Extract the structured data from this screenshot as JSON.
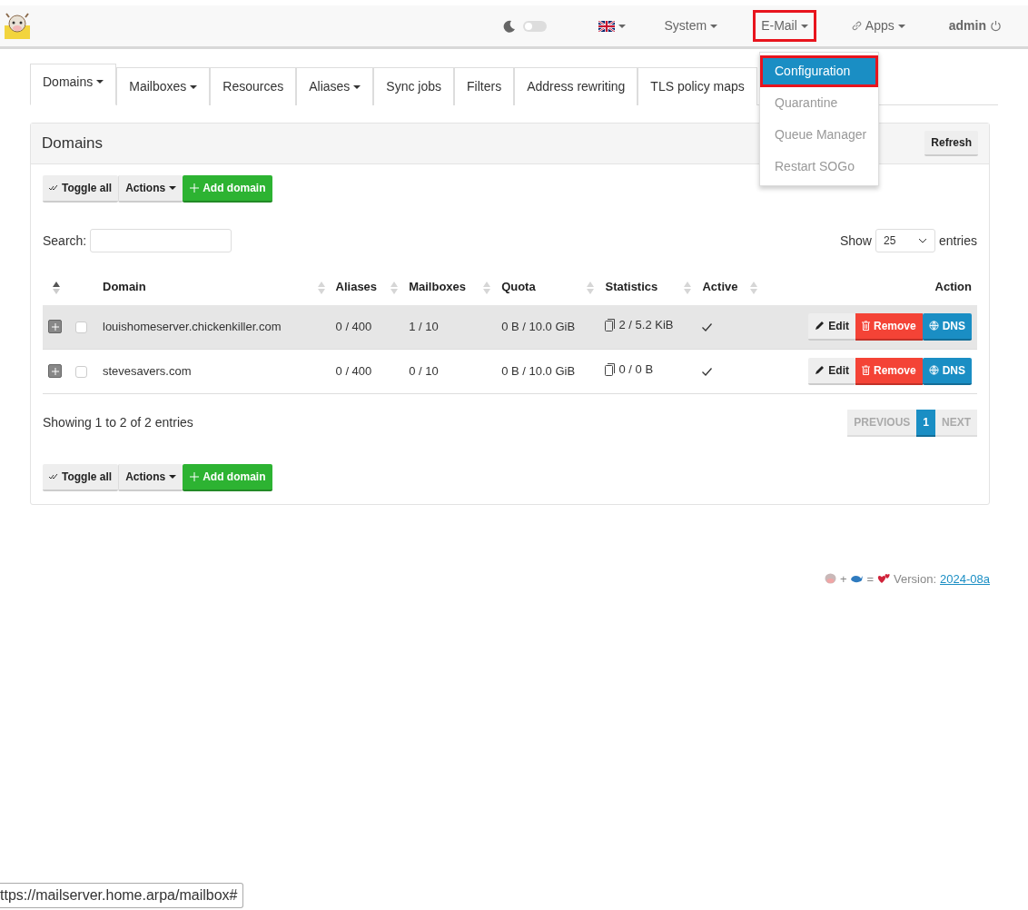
{
  "navbar": {
    "dark_mode_on": false,
    "items": [
      {
        "label": "System",
        "kind": "dropdown",
        "highlighted": false
      },
      {
        "label": "E-Mail",
        "kind": "dropdown",
        "highlighted": true
      },
      {
        "label": "Apps",
        "kind": "link-dropdown",
        "highlighted": false
      },
      {
        "label": "admin",
        "kind": "user",
        "highlighted": false
      }
    ]
  },
  "email_menu": [
    {
      "label": "Configuration",
      "selected": true,
      "highlighted": true
    },
    {
      "label": "Quarantine",
      "selected": false,
      "highlighted": false
    },
    {
      "label": "Queue Manager",
      "selected": false,
      "highlighted": false
    },
    {
      "label": "Restart SOGo",
      "selected": false,
      "highlighted": false
    }
  ],
  "tabs": [
    {
      "label": "Domains",
      "dropdown": true,
      "selected": true
    },
    {
      "label": "Mailboxes",
      "dropdown": true,
      "selected": false
    },
    {
      "label": "Resources",
      "dropdown": false,
      "selected": false
    },
    {
      "label": "Aliases",
      "dropdown": true,
      "selected": false
    },
    {
      "label": "Sync jobs",
      "dropdown": false,
      "selected": false
    },
    {
      "label": "Filters",
      "dropdown": false,
      "selected": false
    },
    {
      "label": "Address rewriting",
      "dropdown": false,
      "selected": false
    },
    {
      "label": "TLS policy maps",
      "dropdown": false,
      "selected": false
    }
  ],
  "panel": {
    "title": "Domains",
    "refresh": "Refresh",
    "toolbar": {
      "toggle": "Toggle all",
      "actions": "Actions",
      "add": "Add domain"
    },
    "search_label": "Search:",
    "show_label": "Show",
    "page_size": "25",
    "entries_label": "entries",
    "columns": [
      {
        "sortable": true,
        "sorted": true
      },
      {
        "label": "Domain",
        "sortable": true,
        "sorted": false
      },
      {
        "label": "Aliases",
        "sortable": true,
        "sorted": false
      },
      {
        "label": "Mailboxes",
        "sortable": true,
        "sorted": false
      },
      {
        "label": "Quota",
        "sortable": true,
        "sorted": false
      },
      {
        "label": "Statistics",
        "sortable": true,
        "sorted": false
      },
      {
        "label": "Active",
        "sortable": true,
        "sorted": false
      },
      {
        "label": "Action",
        "sortable": false
      }
    ],
    "rows": [
      {
        "hovered": true,
        "checked": false,
        "domain": "louishomeserver.chickenkiller.com",
        "aliases": "0 / 400",
        "mailboxes": "1 / 10",
        "quota": "0 B / 10.0 GiB",
        "statistics": "2 / 5.2 KiB",
        "active": true,
        "actions": [
          "Edit",
          "Remove",
          "DNS"
        ]
      },
      {
        "hovered": false,
        "checked": false,
        "domain": "stevesavers.com",
        "aliases": "0 / 400",
        "mailboxes": "0 / 10",
        "quota": "0 B / 10.0 GiB",
        "statistics": "0 / 0 B",
        "active": true,
        "actions": [
          "Edit",
          "Remove",
          "DNS"
        ]
      }
    ],
    "summary": "Showing 1 to 2 of 2 entries",
    "pagination": {
      "previous": "PREVIOUS",
      "pages": [
        {
          "label": "1",
          "selected": true
        }
      ],
      "next": "NEXT"
    },
    "bottom_toolbar": {
      "toggle": "Toggle all",
      "actions": "Actions",
      "add": "Add domain"
    }
  },
  "footer": {
    "plus": "+",
    "equals": "=",
    "version_label": "Version:",
    "version": "2024-08a"
  },
  "status_url": "ttps://mailserver.home.arpa/mailbox#"
}
